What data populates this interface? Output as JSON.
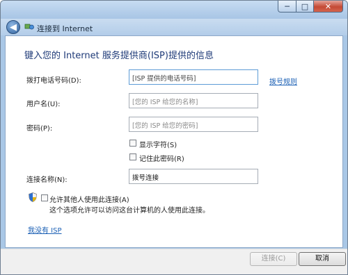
{
  "window": {
    "title": "连接到 Internet"
  },
  "page": {
    "heading": "键入您的 Internet 服务提供商(ISP)提供的信息"
  },
  "form": {
    "phone": {
      "label": "拨打电话号码(D):",
      "value": "[ISP 提供的电话号码]"
    },
    "dialing_rules_link": "拨号规则",
    "username": {
      "label": "用户名(U):",
      "value": "[您的 ISP 给您的名称]"
    },
    "password": {
      "label": "密码(P):",
      "value": "[您的 ISP 给您的密码]"
    },
    "show_chars": {
      "label": "显示字符(S)",
      "checked": false
    },
    "remember_password": {
      "label": "记住此密码(R)",
      "checked": false
    },
    "connection_name": {
      "label": "连接名称(N):",
      "value": "拨号连接"
    },
    "allow_others": {
      "label": "允许其他人使用此连接(A)",
      "checked": false,
      "note": "这个选项允许可以访问这台计算机的人使用此连接。"
    },
    "no_isp_link": "我没有 ISP"
  },
  "buttons": {
    "connect": "连接(C)",
    "cancel": "取消"
  },
  "icons": {
    "back": "back-arrow-icon",
    "network": "network-icon",
    "shield": "uac-shield-icon"
  },
  "colors": {
    "heading": "#1e3a78",
    "link": "#1a5fb4",
    "titlebar": "#a8c5e5"
  }
}
